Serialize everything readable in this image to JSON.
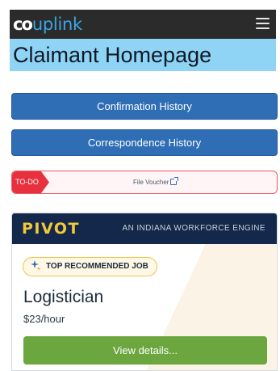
{
  "app": {
    "logo_prefix": "co",
    "logo_brand": "uplink",
    "menu_icon": "hamburger-icon"
  },
  "page": {
    "title": "Claimant Homepage"
  },
  "actions": {
    "confirmation_history": "Confirmation History",
    "correspondence_history": "Correspondence History"
  },
  "todo": {
    "tag": "TO-DO",
    "item": "File Voucher",
    "item_icon": "external-link-icon",
    "colors": {
      "tag": "#e8313e",
      "border": "#e85a63"
    }
  },
  "pivot": {
    "logo": "PIVOT",
    "tagline": "AN INDIANA WORKFORCE ENGINE",
    "badge": "TOP RECOMMENDED JOB",
    "badge_icon": "sparkle-icon",
    "job_title": "Logistician",
    "job_pay": "$23/hour",
    "cta": "View details...",
    "colors": {
      "header": "#13284a",
      "logo": "#f3c93a",
      "cta": "#6ba63f"
    }
  }
}
